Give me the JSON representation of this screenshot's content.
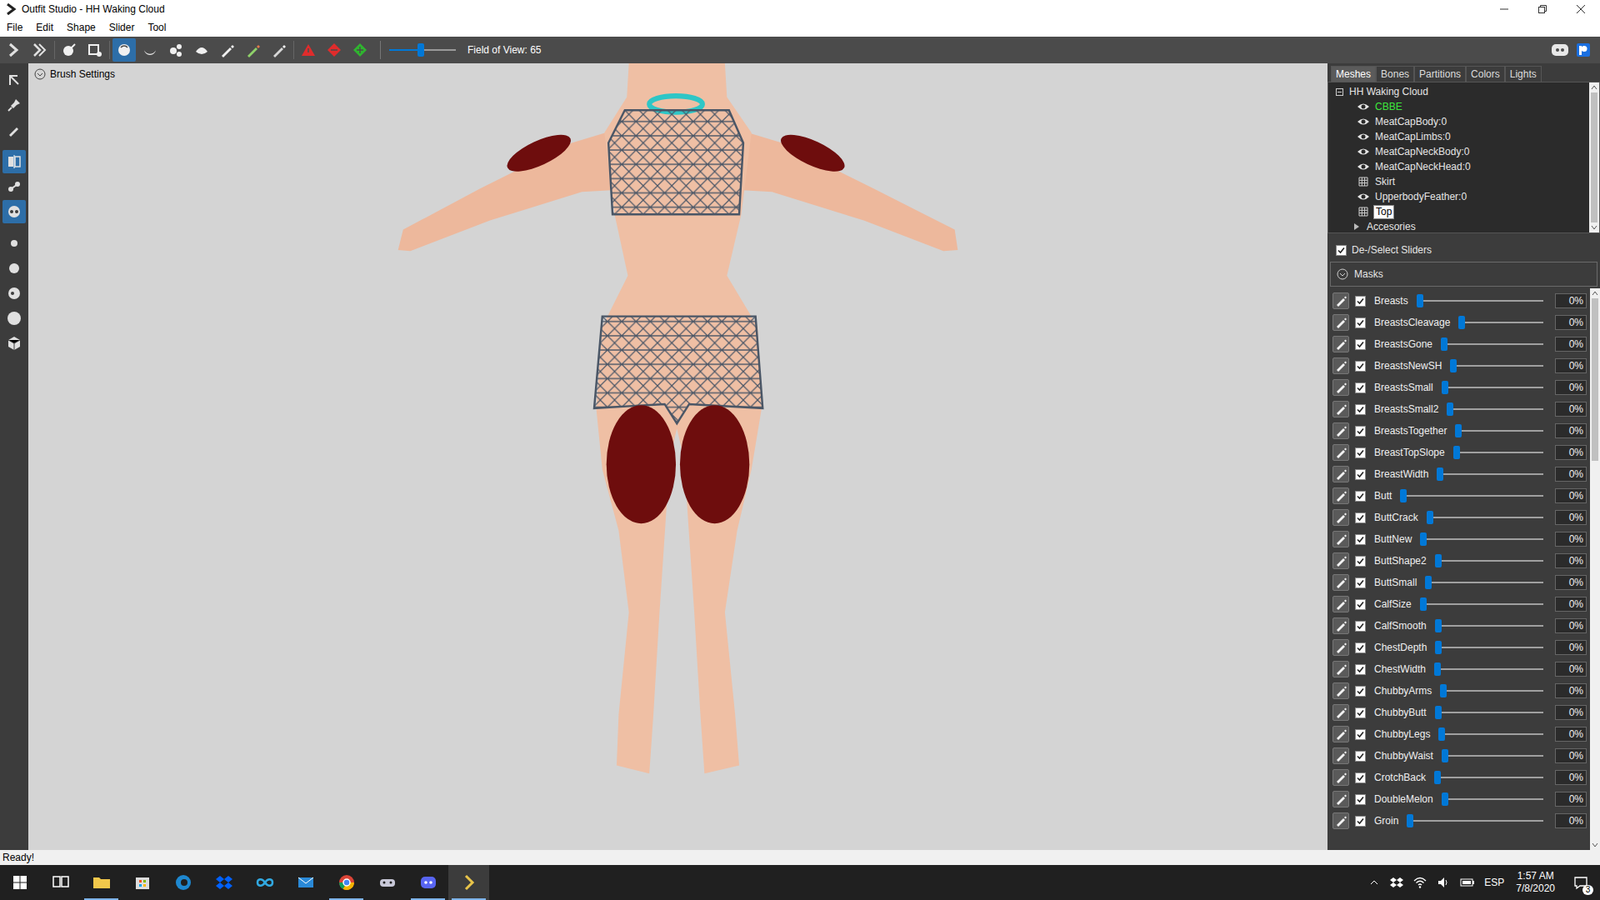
{
  "window": {
    "title": "Outfit Studio - HH Waking Cloud"
  },
  "menu": [
    "File",
    "Edit",
    "Shape",
    "Slider",
    "Tool"
  ],
  "toolbar": {
    "tools": [
      {
        "kind": "app",
        "selected": false
      },
      {
        "kind": "next",
        "selected": false
      },
      {
        "kind": "brush",
        "selected": false
      },
      {
        "kind": "select",
        "selected": false
      },
      {
        "kind": "inflate",
        "selected": true
      },
      {
        "kind": "deflate",
        "selected": false
      },
      {
        "kind": "move",
        "selected": false
      },
      {
        "kind": "smooth",
        "selected": false
      },
      {
        "kind": "pen",
        "selected": false
      },
      {
        "kind": "color",
        "selected": false
      },
      {
        "kind": "paint",
        "selected": false
      },
      {
        "kind": "warn",
        "selected": false
      },
      {
        "kind": "minus",
        "selected": false
      },
      {
        "kind": "plus",
        "selected": false
      }
    ],
    "fov_level": 0.47,
    "fov_label": "Field of View: 65"
  },
  "left_tools": [
    {
      "kind": "arrow",
      "selected": false
    },
    {
      "kind": "pin",
      "selected": false
    },
    {
      "kind": "pen",
      "selected": false
    },
    {
      "kind": "mirror",
      "selected": true
    },
    {
      "kind": "connected",
      "selected": false
    },
    {
      "kind": "xray",
      "selected": true
    },
    {
      "kind": "circle-s",
      "selected": false
    },
    {
      "kind": "circle-m",
      "selected": false
    },
    {
      "kind": "circle-l",
      "selected": false
    },
    {
      "kind": "circle-xl",
      "selected": false
    },
    {
      "kind": "cube",
      "selected": false
    }
  ],
  "viewport": {
    "brush_settings": "Brush Settings"
  },
  "panel_tabs": [
    {
      "label": "Meshes",
      "selected": true
    },
    {
      "label": "Bones",
      "selected": false
    },
    {
      "label": "Partitions",
      "selected": false
    },
    {
      "label": "Colors",
      "selected": false
    },
    {
      "label": "Lights",
      "selected": false
    }
  ],
  "tree": {
    "root": "HH Waking Cloud",
    "expanded": true,
    "items": [
      {
        "label": "CBBE",
        "kind": "eye",
        "reference": true,
        "selected": false
      },
      {
        "label": "MeatCapBody:0",
        "kind": "eye",
        "reference": false,
        "selected": false
      },
      {
        "label": "MeatCapLimbs:0",
        "kind": "eye",
        "reference": false,
        "selected": false
      },
      {
        "label": "MeatCapNeckBody:0",
        "kind": "eye",
        "reference": false,
        "selected": false
      },
      {
        "label": "MeatCapNeckHead:0",
        "kind": "eye",
        "reference": false,
        "selected": false
      },
      {
        "label": "Skirt",
        "kind": "wireframe",
        "reference": false,
        "selected": false
      },
      {
        "label": "UpperbodyFeather:0",
        "kind": "eye",
        "reference": false,
        "selected": false
      },
      {
        "label": "Top",
        "kind": "wireframe",
        "reference": false,
        "selected": true
      },
      {
        "label": "Accesories",
        "kind": "group",
        "reference": false,
        "selected": false
      }
    ]
  },
  "select_all": {
    "label": "De-/Select Sliders",
    "checked": true
  },
  "masks": {
    "label": "Masks",
    "expanded": true
  },
  "sliders": [
    {
      "name": "Breasts",
      "checked": true,
      "level": 0,
      "reading": "0%"
    },
    {
      "name": "BreastsCleavage",
      "checked": true,
      "level": 0,
      "reading": "0%"
    },
    {
      "name": "BreastsGone",
      "checked": true,
      "level": 0,
      "reading": "0%"
    },
    {
      "name": "BreastsNewSH",
      "checked": true,
      "level": 0,
      "reading": "0%"
    },
    {
      "name": "BreastsSmall",
      "checked": true,
      "level": 0,
      "reading": "0%"
    },
    {
      "name": "BreastsSmall2",
      "checked": true,
      "level": 0,
      "reading": "0%"
    },
    {
      "name": "BreastsTogether",
      "checked": true,
      "level": 0,
      "reading": "0%"
    },
    {
      "name": "BreastTopSlope",
      "checked": true,
      "level": 0,
      "reading": "0%"
    },
    {
      "name": "BreastWidth",
      "checked": true,
      "level": 0,
      "reading": "0%"
    },
    {
      "name": "Butt",
      "checked": true,
      "level": 0,
      "reading": "0%"
    },
    {
      "name": "ButtCrack",
      "checked": true,
      "level": 0,
      "reading": "0%"
    },
    {
      "name": "ButtNew",
      "checked": true,
      "level": 0,
      "reading": "0%"
    },
    {
      "name": "ButtShape2",
      "checked": true,
      "level": 0,
      "reading": "0%"
    },
    {
      "name": "ButtSmall",
      "checked": true,
      "level": 0,
      "reading": "0%"
    },
    {
      "name": "CalfSize",
      "checked": true,
      "level": 0,
      "reading": "0%"
    },
    {
      "name": "CalfSmooth",
      "checked": true,
      "level": 0,
      "reading": "0%"
    },
    {
      "name": "ChestDepth",
      "checked": true,
      "level": 0,
      "reading": "0%"
    },
    {
      "name": "ChestWidth",
      "checked": true,
      "level": 0,
      "reading": "0%"
    },
    {
      "name": "ChubbyArms",
      "checked": true,
      "level": 0,
      "reading": "0%"
    },
    {
      "name": "ChubbyButt",
      "checked": true,
      "level": 0,
      "reading": "0%"
    },
    {
      "name": "ChubbyLegs",
      "checked": true,
      "level": 0,
      "reading": "0%"
    },
    {
      "name": "ChubbyWaist",
      "checked": true,
      "level": 0,
      "reading": "0%"
    },
    {
      "name": "CrotchBack",
      "checked": true,
      "level": 0,
      "reading": "0%"
    },
    {
      "name": "DoubleMelon",
      "checked": true,
      "level": 0,
      "reading": "0%"
    },
    {
      "name": "Groin",
      "checked": true,
      "level": 0,
      "reading": "0%"
    }
  ],
  "status_bar": "Ready!",
  "taskbar": {
    "apps": [
      {
        "kind": "taskview",
        "running": false,
        "selected": false
      },
      {
        "kind": "explorer",
        "running": true,
        "selected": false
      },
      {
        "kind": "store",
        "running": false,
        "selected": false
      },
      {
        "kind": "edge",
        "running": false,
        "selected": false
      },
      {
        "kind": "dropbox",
        "running": false,
        "selected": false
      },
      {
        "kind": "infinity",
        "running": false,
        "selected": false
      },
      {
        "kind": "mail",
        "running": false,
        "selected": false
      },
      {
        "kind": "chrome",
        "running": true,
        "selected": false
      },
      {
        "kind": "game",
        "running": false,
        "selected": false
      },
      {
        "kind": "discord",
        "running": true,
        "selected": false
      },
      {
        "kind": "outfit",
        "running": true,
        "selected": true
      }
    ],
    "language": "ESP",
    "time": "1:57 AM",
    "date": "7/8/2020",
    "notifications": "3"
  }
}
